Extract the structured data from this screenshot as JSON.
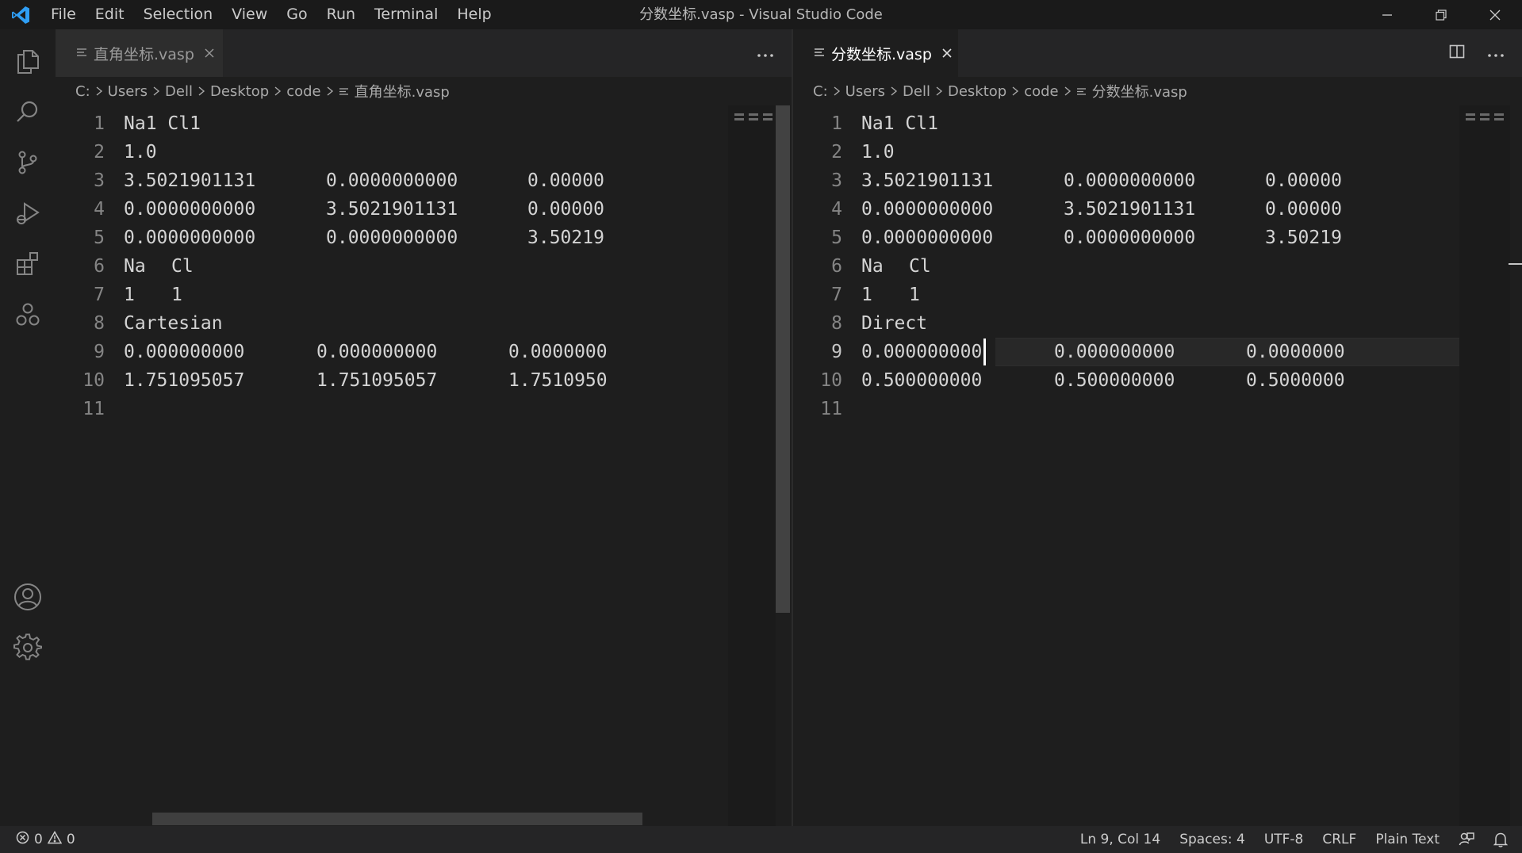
{
  "window": {
    "title": "分数坐标.vasp - Visual Studio Code",
    "menu": [
      "File",
      "Edit",
      "Selection",
      "View",
      "Go",
      "Run",
      "Terminal",
      "Help"
    ]
  },
  "activity_bar": {
    "icons": [
      "files-icon",
      "search-icon",
      "source-control-icon",
      "run-debug-icon",
      "extensions-icon",
      "remote-icon",
      "account-icon",
      "settings-gear-icon"
    ]
  },
  "left_editor": {
    "tab": {
      "label": "直角坐标.vasp",
      "active": false
    },
    "breadcrumb": [
      "C:",
      "Users",
      "Dell",
      "Desktop",
      "code",
      "直角坐标.vasp"
    ],
    "lines": [
      {
        "n": "1",
        "cols": [
          "Na1 Cl1"
        ]
      },
      {
        "n": "2",
        "cols": [
          "1.0"
        ]
      },
      {
        "n": "3",
        "cols": [
          "3.5021901131",
          "0.0000000000",
          "0.00000"
        ]
      },
      {
        "n": "4",
        "cols": [
          "0.0000000000",
          "3.5021901131",
          "0.00000"
        ]
      },
      {
        "n": "5",
        "cols": [
          "0.0000000000",
          "0.0000000000",
          "3.50219"
        ]
      },
      {
        "n": "6",
        "cols": [
          "Na",
          "Cl"
        ]
      },
      {
        "n": "7",
        "cols": [
          "1",
          "1"
        ]
      },
      {
        "n": "8",
        "cols": [
          "Cartesian"
        ]
      },
      {
        "n": "9",
        "cols": [
          "0.000000000",
          "0.000000000",
          "0.0000000"
        ]
      },
      {
        "n": "10",
        "cols": [
          "1.751095057",
          "1.751095057",
          "1.7510950"
        ]
      },
      {
        "n": "11",
        "cols": []
      }
    ]
  },
  "right_editor": {
    "tab": {
      "label": "分数坐标.vasp",
      "active": true
    },
    "breadcrumb": [
      "C:",
      "Users",
      "Dell",
      "Desktop",
      "code",
      "分数坐标.vasp"
    ],
    "lines": [
      {
        "n": "1",
        "cols": [
          "Na1 Cl1"
        ]
      },
      {
        "n": "2",
        "cols": [
          "1.0"
        ]
      },
      {
        "n": "3",
        "cols": [
          "3.5021901131",
          "0.0000000000",
          "0.00000"
        ]
      },
      {
        "n": "4",
        "cols": [
          "0.0000000000",
          "3.5021901131",
          "0.00000"
        ]
      },
      {
        "n": "5",
        "cols": [
          "0.0000000000",
          "0.0000000000",
          "3.50219"
        ]
      },
      {
        "n": "6",
        "cols": [
          "Na",
          "Cl"
        ]
      },
      {
        "n": "7",
        "cols": [
          "1",
          "1"
        ]
      },
      {
        "n": "8",
        "cols": [
          "Direct"
        ]
      },
      {
        "n": "9",
        "cols": [
          "0.000000000",
          "0.000000000",
          "0.0000000"
        ]
      },
      {
        "n": "10",
        "cols": [
          "0.500000000",
          "0.500000000",
          "0.5000000"
        ]
      },
      {
        "n": "11",
        "cols": []
      }
    ],
    "cursor_line": 9
  },
  "status_bar": {
    "errors": "0",
    "warnings": "0",
    "position": "Ln 9, Col 14",
    "indent": "Spaces: 4",
    "encoding": "UTF-8",
    "eol": "CRLF",
    "language": "Plain Text"
  },
  "colors": {
    "accent": "#007acc",
    "editor_bg": "#1e1e1e",
    "status_bg": "#252526"
  }
}
